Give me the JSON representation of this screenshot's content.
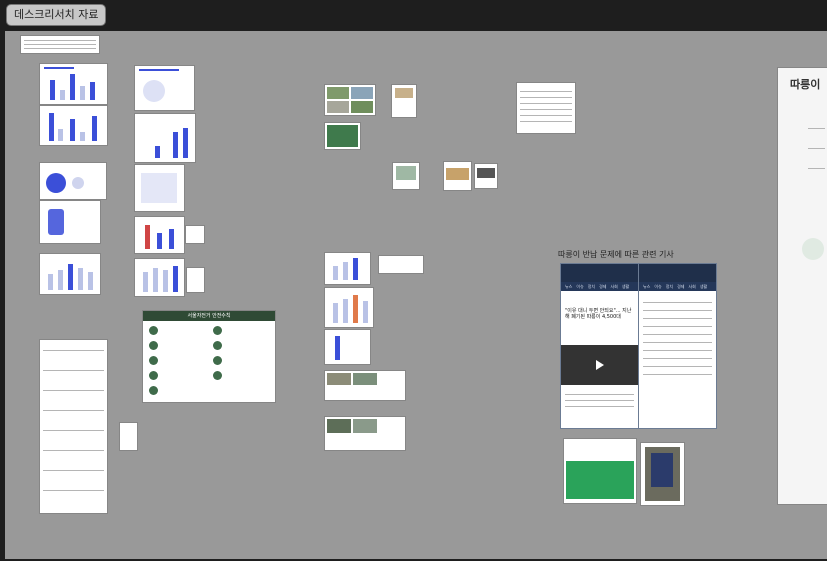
{
  "board": {
    "title": "데스크리서치 자료"
  },
  "section": {
    "article_title": "따릉이 반납 문제에 따른 관련 기사"
  },
  "right_panel": {
    "heading": "따릉이"
  },
  "safety_card": {
    "header": "서울자전거 안전수칙"
  },
  "article": {
    "headline": "\"이유 대니 두면 안되요\"... 지난해 폐기된 따릉이 4,500대",
    "tab_labels": [
      "뉴스",
      "이슈",
      "정치",
      "경제",
      "사회",
      "생활"
    ]
  },
  "colors": {
    "board": "#999999",
    "frame": "#1e1e1e",
    "accent_blue": "#3b4fd8",
    "safety_green": "#2f4a35",
    "app_navy": "#1f2f4a"
  }
}
